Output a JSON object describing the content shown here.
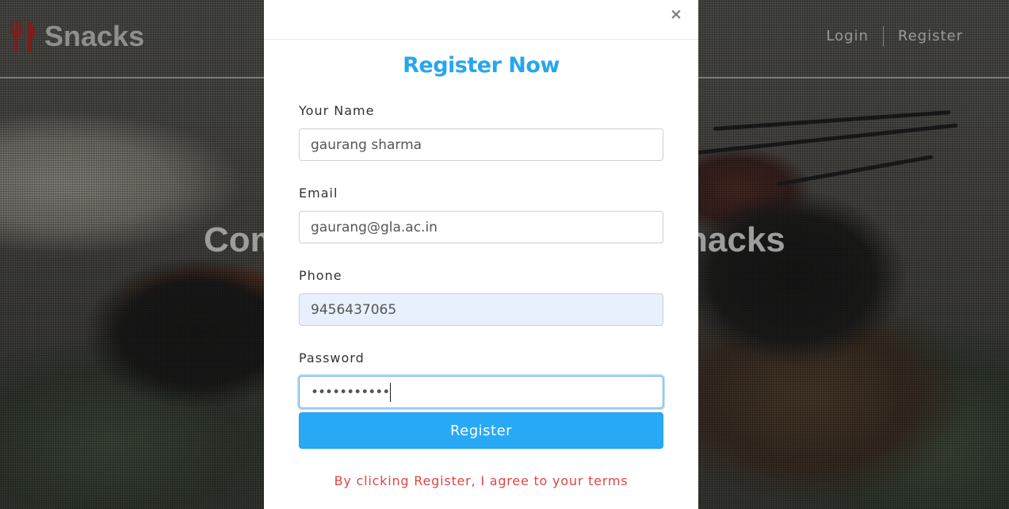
{
  "background_page": {
    "brand": {
      "name": "Snacks",
      "icon": "fork-knife-icon",
      "icon_color": "#8b1a1a"
    },
    "nav": {
      "login_label": "Login",
      "register_label": "Register"
    },
    "hero_left": "Com",
    "hero_right": "nacks"
  },
  "modal": {
    "close_label": "×",
    "title": "Register Now",
    "fields": {
      "name": {
        "label": "Your Name",
        "value": "gaurang sharma"
      },
      "email": {
        "label": "Email",
        "value": "gaurang@gla.ac.in"
      },
      "phone": {
        "label": "Phone",
        "value": "9456437065"
      },
      "password": {
        "label": "Password",
        "value": "•••••••••••"
      }
    },
    "submit_label": "Register",
    "terms_text": "By clicking Register, I agree to your terms"
  },
  "colors": {
    "accent": "#27a9f6",
    "title": "#27a6ef",
    "terms": "#e04444",
    "autofill": "#e8f0fe"
  }
}
